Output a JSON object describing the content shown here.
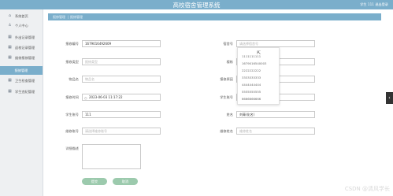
{
  "header": {
    "title": "高校宿舍管理系统",
    "user_info": "学生 111  退出登录"
  },
  "sidebar": {
    "items": [
      {
        "icon": "home-icon",
        "glyph": "⌂",
        "label": "系统首页"
      },
      {
        "icon": "user-icon",
        "glyph": "♙",
        "label": "个人中心"
      },
      {
        "icon": "grid-icon",
        "glyph": "▦",
        "label": "外出记录管理"
      },
      {
        "icon": "grid-icon",
        "glyph": "▦",
        "label": "返校记录管理"
      },
      {
        "icon": "grid-icon",
        "glyph": "▦",
        "label": "维修报修管理"
      },
      {
        "icon": "",
        "glyph": "",
        "label": "报修管理"
      },
      {
        "icon": "grid-icon",
        "glyph": "▦",
        "label": "卫生检查管理"
      },
      {
        "icon": "grid-icon",
        "glyph": "▦",
        "label": "学生违纪管理"
      }
    ]
  },
  "breadcrumb": {
    "first": "报修管理",
    "second": "报修管理"
  },
  "form": {
    "report_no": {
      "label": "报修编号",
      "value": "1679016492609"
    },
    "dorm_no": {
      "label": "宿舍号",
      "placeholder": "请选择宿舍号"
    },
    "report_type": {
      "label": "报修类型",
      "placeholder": "报修类型"
    },
    "building": {
      "label": "楼栋"
    },
    "item_name": {
      "label": "物品名",
      "placeholder": "物品名"
    },
    "repair_reason": {
      "label": "报修原因"
    },
    "report_time": {
      "label": "报修时间",
      "value": "2023-06-03 11:17:22"
    },
    "student_no_right": {
      "label": "学生账号"
    },
    "student_no": {
      "label": "学生账号",
      "value": "111"
    },
    "name": {
      "label": "姓名",
      "value": "刘青(化名)"
    },
    "staff_no": {
      "label": "维修账号",
      "placeholder": "请选择维修账号"
    },
    "staff_name": {
      "label": "维修姓名",
      "placeholder": "维修姓名"
    },
    "remark": {
      "label": "详细描述"
    }
  },
  "dropdown_options": [
    "1111111111",
    "1679016540003",
    "2222222222",
    "3333333333",
    "4444444444",
    "5555555555",
    "6666666666"
  ],
  "buttons": {
    "submit": "提交",
    "cancel": "取消"
  },
  "watermark": "CSDN @清风学长"
}
